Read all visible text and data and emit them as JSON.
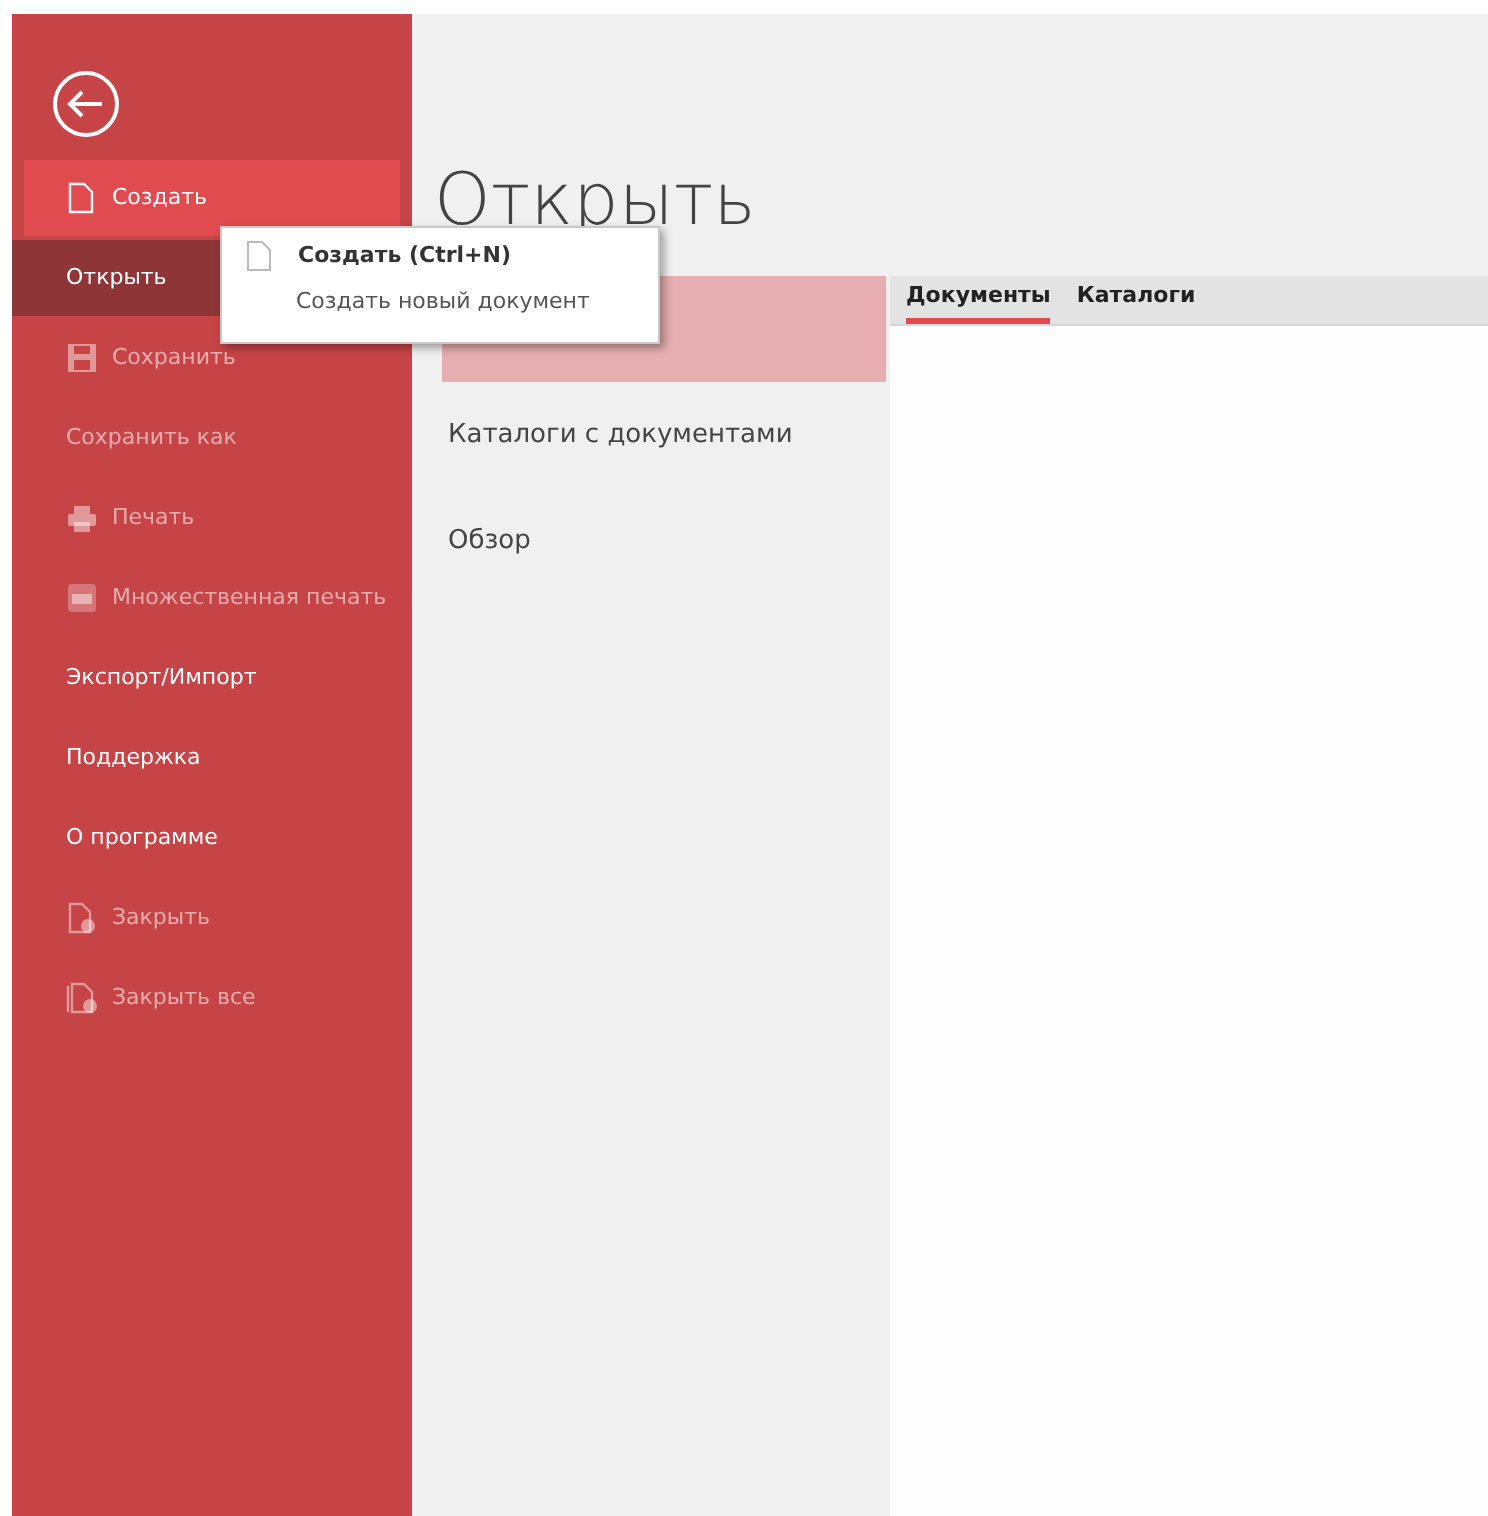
{
  "sidebar": {
    "items": [
      {
        "label": "Создать",
        "kind": "new",
        "selected": false,
        "highlighted": true,
        "disabled": false
      },
      {
        "label": "Открыть",
        "selected": true,
        "highlighted": false,
        "disabled": false
      },
      {
        "label": "Сохранить",
        "kind": "save",
        "selected": false,
        "highlighted": false,
        "disabled": true
      },
      {
        "label": "Сохранить как",
        "selected": false,
        "highlighted": false,
        "disabled": true
      },
      {
        "label": "Печать",
        "kind": "print",
        "selected": false,
        "highlighted": false,
        "disabled": true
      },
      {
        "label": "Множественная печать",
        "kind": "multiprint",
        "selected": false,
        "highlighted": false,
        "disabled": true
      },
      {
        "label": "Экспорт/Импорт",
        "selected": false,
        "highlighted": false,
        "disabled": false
      },
      {
        "label": "Поддержка",
        "selected": false,
        "highlighted": false,
        "disabled": false
      },
      {
        "label": "О программе",
        "selected": false,
        "highlighted": false,
        "disabled": false
      },
      {
        "label": "Закрыть",
        "kind": "close",
        "selected": false,
        "highlighted": false,
        "disabled": true
      },
      {
        "label": "Закрыть все",
        "kind": "closeall",
        "selected": false,
        "highlighted": false,
        "disabled": true
      }
    ]
  },
  "heading": "Открыть",
  "places": [
    {
      "selected": true
    },
    {
      "label": "Каталоги с документами",
      "selected": false
    },
    {
      "label": "Обзор",
      "selected": false
    }
  ],
  "tabs": [
    {
      "label": "Документы",
      "selected": true
    },
    {
      "label": "Каталоги",
      "selected": false
    }
  ],
  "tooltip": {
    "title": "Создать (Ctrl+N)",
    "description": "Создать новый документ"
  }
}
